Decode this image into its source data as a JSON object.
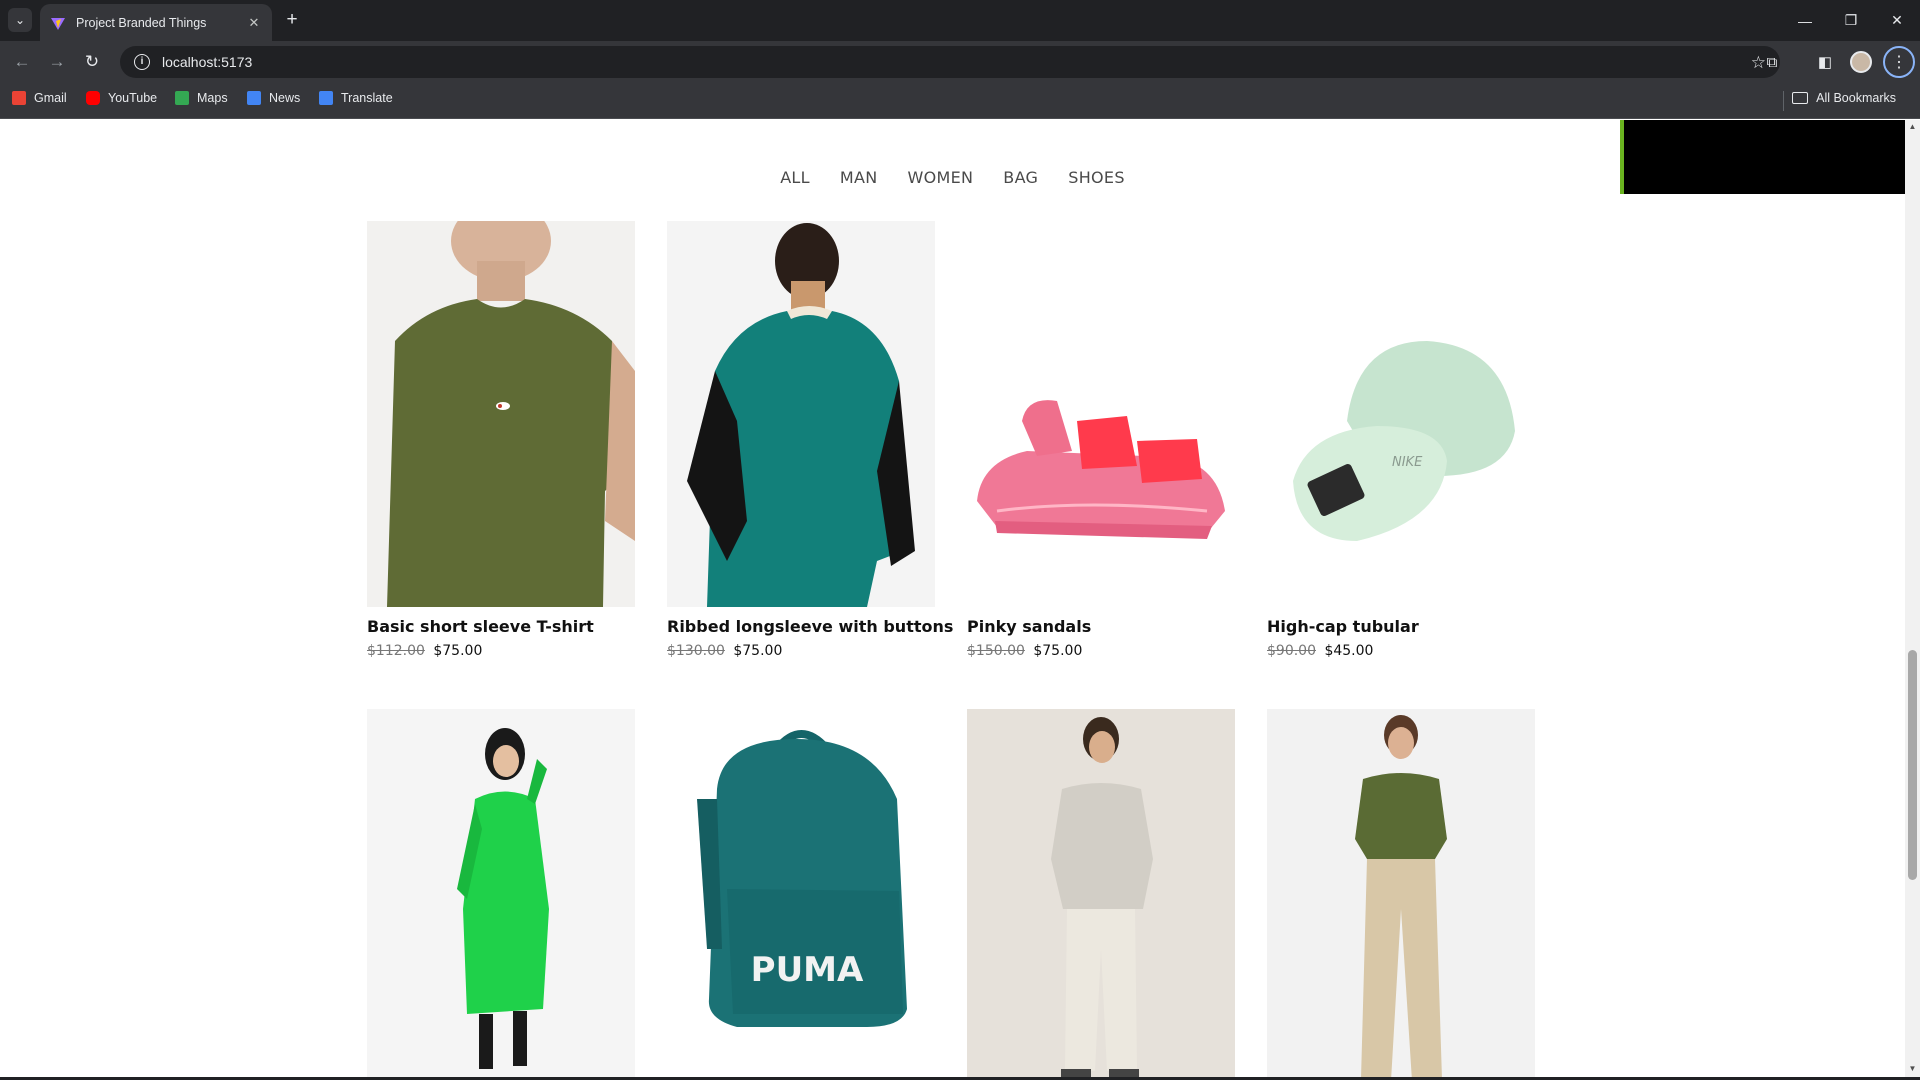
{
  "browser": {
    "tab_title": "Project Branded Things",
    "url": "localhost:5173",
    "bookmarks": [
      {
        "label": "Gmail",
        "color": "#ea4335"
      },
      {
        "label": "YouTube",
        "color": "#ff0000"
      },
      {
        "label": "Maps",
        "color": "#34a853"
      },
      {
        "label": "News",
        "color": "#4285f4"
      },
      {
        "label": "Translate",
        "color": "#4285f4"
      }
    ],
    "all_bookmarks": "All Bookmarks"
  },
  "categories": [
    "ALL",
    "MAN",
    "WOMEN",
    "BAG",
    "SHOES"
  ],
  "products": [
    {
      "name": "Basic short sleeve T-shirt",
      "old_price": "$112.00",
      "price": "$75.00",
      "image": "olive-tshirt"
    },
    {
      "name": "Ribbed longsleeve with buttons",
      "old_price": "$130.00",
      "price": "$75.00",
      "image": "teal-longsleeve"
    },
    {
      "name": "Pinky sandals",
      "old_price": "$150.00",
      "price": "$75.00",
      "image": "pink-sandals"
    },
    {
      "name": "High-cap tubular",
      "old_price": "$90.00",
      "price": "$45.00",
      "image": "mint-cap"
    },
    {
      "name": "",
      "old_price": "",
      "price": "",
      "image": "green-dress"
    },
    {
      "name": "",
      "old_price": "",
      "price": "",
      "image": "teal-backpack",
      "brand_text": "PUMA"
    },
    {
      "name": "",
      "old_price": "",
      "price": "",
      "image": "linen-shirt"
    },
    {
      "name": "",
      "old_price": "",
      "price": "",
      "image": "olive-tshirt-chinos"
    }
  ]
}
